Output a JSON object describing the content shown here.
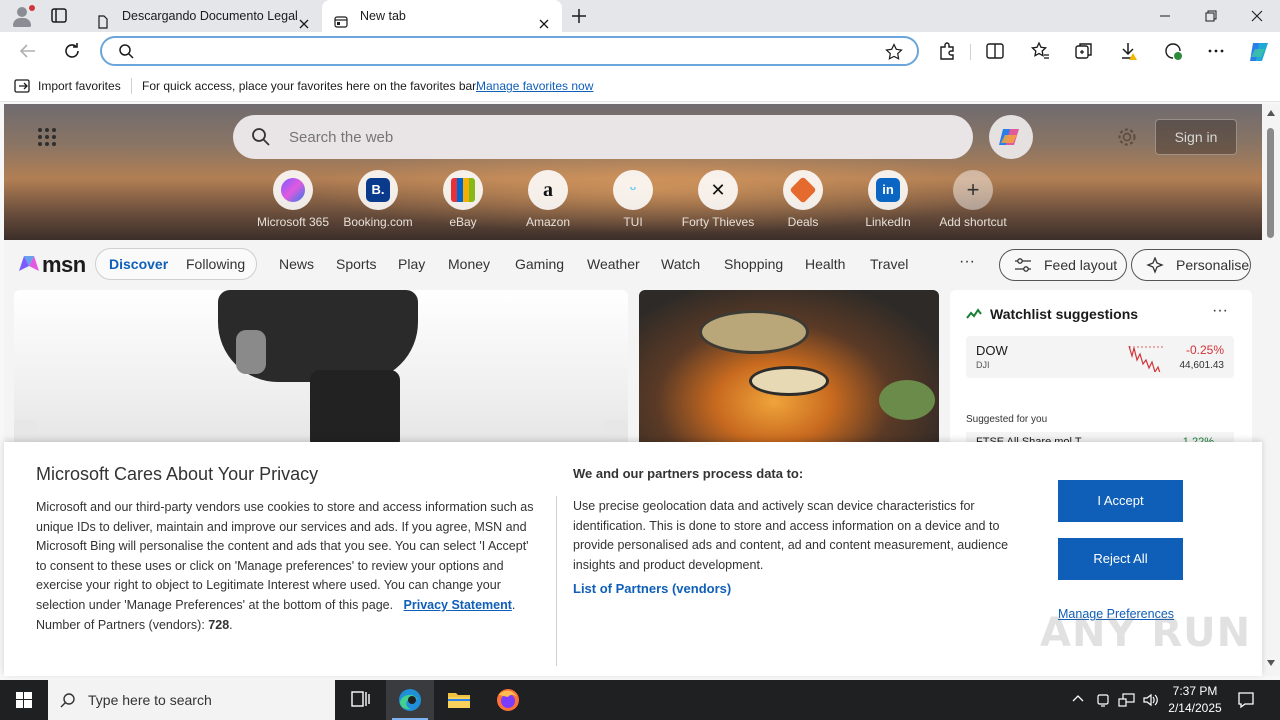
{
  "browser": {
    "tabs": [
      {
        "title": "Descargando Documento Legal"
      },
      {
        "title": "New tab"
      }
    ],
    "address": {
      "value": "",
      "placeholder": ""
    },
    "favorites_bar": {
      "import_label": "Import favorites",
      "message": "For quick access, place your favorites here on the favorites bar.",
      "manage_link": "Manage favorites now"
    }
  },
  "msn": {
    "search_placeholder": "Search the web",
    "signin_label": "Sign in",
    "shortcuts": [
      {
        "label": "Microsoft 365",
        "icon": "microsoft365-icon"
      },
      {
        "label": "Booking.com",
        "icon": "booking-icon"
      },
      {
        "label": "eBay",
        "icon": "ebay-icon"
      },
      {
        "label": "Amazon",
        "icon": "amazon-icon"
      },
      {
        "label": "TUI",
        "icon": "tui-icon"
      },
      {
        "label": "Forty Thieves",
        "icon": "forty-thieves-icon"
      },
      {
        "label": "Deals",
        "icon": "deals-icon"
      },
      {
        "label": "LinkedIn",
        "icon": "linkedin-icon"
      },
      {
        "label": "Add shortcut",
        "icon": "plus-icon"
      }
    ],
    "logo_text": "msn",
    "feed_tabs": {
      "discover": "Discover",
      "following": "Following"
    },
    "nav": [
      "News",
      "Sports",
      "Play",
      "Money",
      "Gaming",
      "Weather",
      "Watch",
      "Shopping",
      "Health",
      "Travel"
    ],
    "nav_more": "···",
    "feed_layout_label": "Feed layout",
    "personalise_label": "Personalise",
    "watchlist": {
      "title": "Watchlist suggestions",
      "more": "···",
      "item": {
        "symbol": "DOW",
        "sub": "DJI",
        "change": "-0.25%",
        "value": "44,601.43"
      },
      "suggested_label": "Suggested for you",
      "item2": {
        "symbol": "FTSE All Share mol T",
        "change": "1.22%"
      }
    }
  },
  "privacy": {
    "title": "Microsoft Cares About Your Privacy",
    "body": "Microsoft and our third-party vendors use cookies to store and access information such as unique IDs to deliver, maintain and improve our services and ads. If you agree, MSN and Microsoft Bing will personalise the content and ads that you see. You can select 'I Accept' to consent to these uses or click on 'Manage preferences' to review your options and exercise your right to object to Legitimate Interest where used.  You can change your selection under 'Manage Preferences' at the bottom of this page.",
    "privacy_link": "Privacy Statement",
    "partners_label": "Number of Partners (vendors):",
    "partners_count": "728",
    "right_title": "We and our partners process data to:",
    "right_body": "Use precise geolocation data and actively scan device characteristics for identification. This is done to store and access information on a device and to provide personalised ads and content, ad and content measurement, audience insights and product development.",
    "vendors_link": "List of Partners (vendors)",
    "accept": "I Accept",
    "reject": "Reject All",
    "manage": "Manage Preferences",
    "watermark": "ANY RUN"
  },
  "taskbar": {
    "search_placeholder": "Type here to search",
    "time": "7:37 PM",
    "date": "2/14/2025"
  },
  "colors": {
    "accent": "#0f5fb8",
    "negative": "#d13438",
    "positive": "#1a7f37",
    "taskbar": "#1f2022"
  }
}
